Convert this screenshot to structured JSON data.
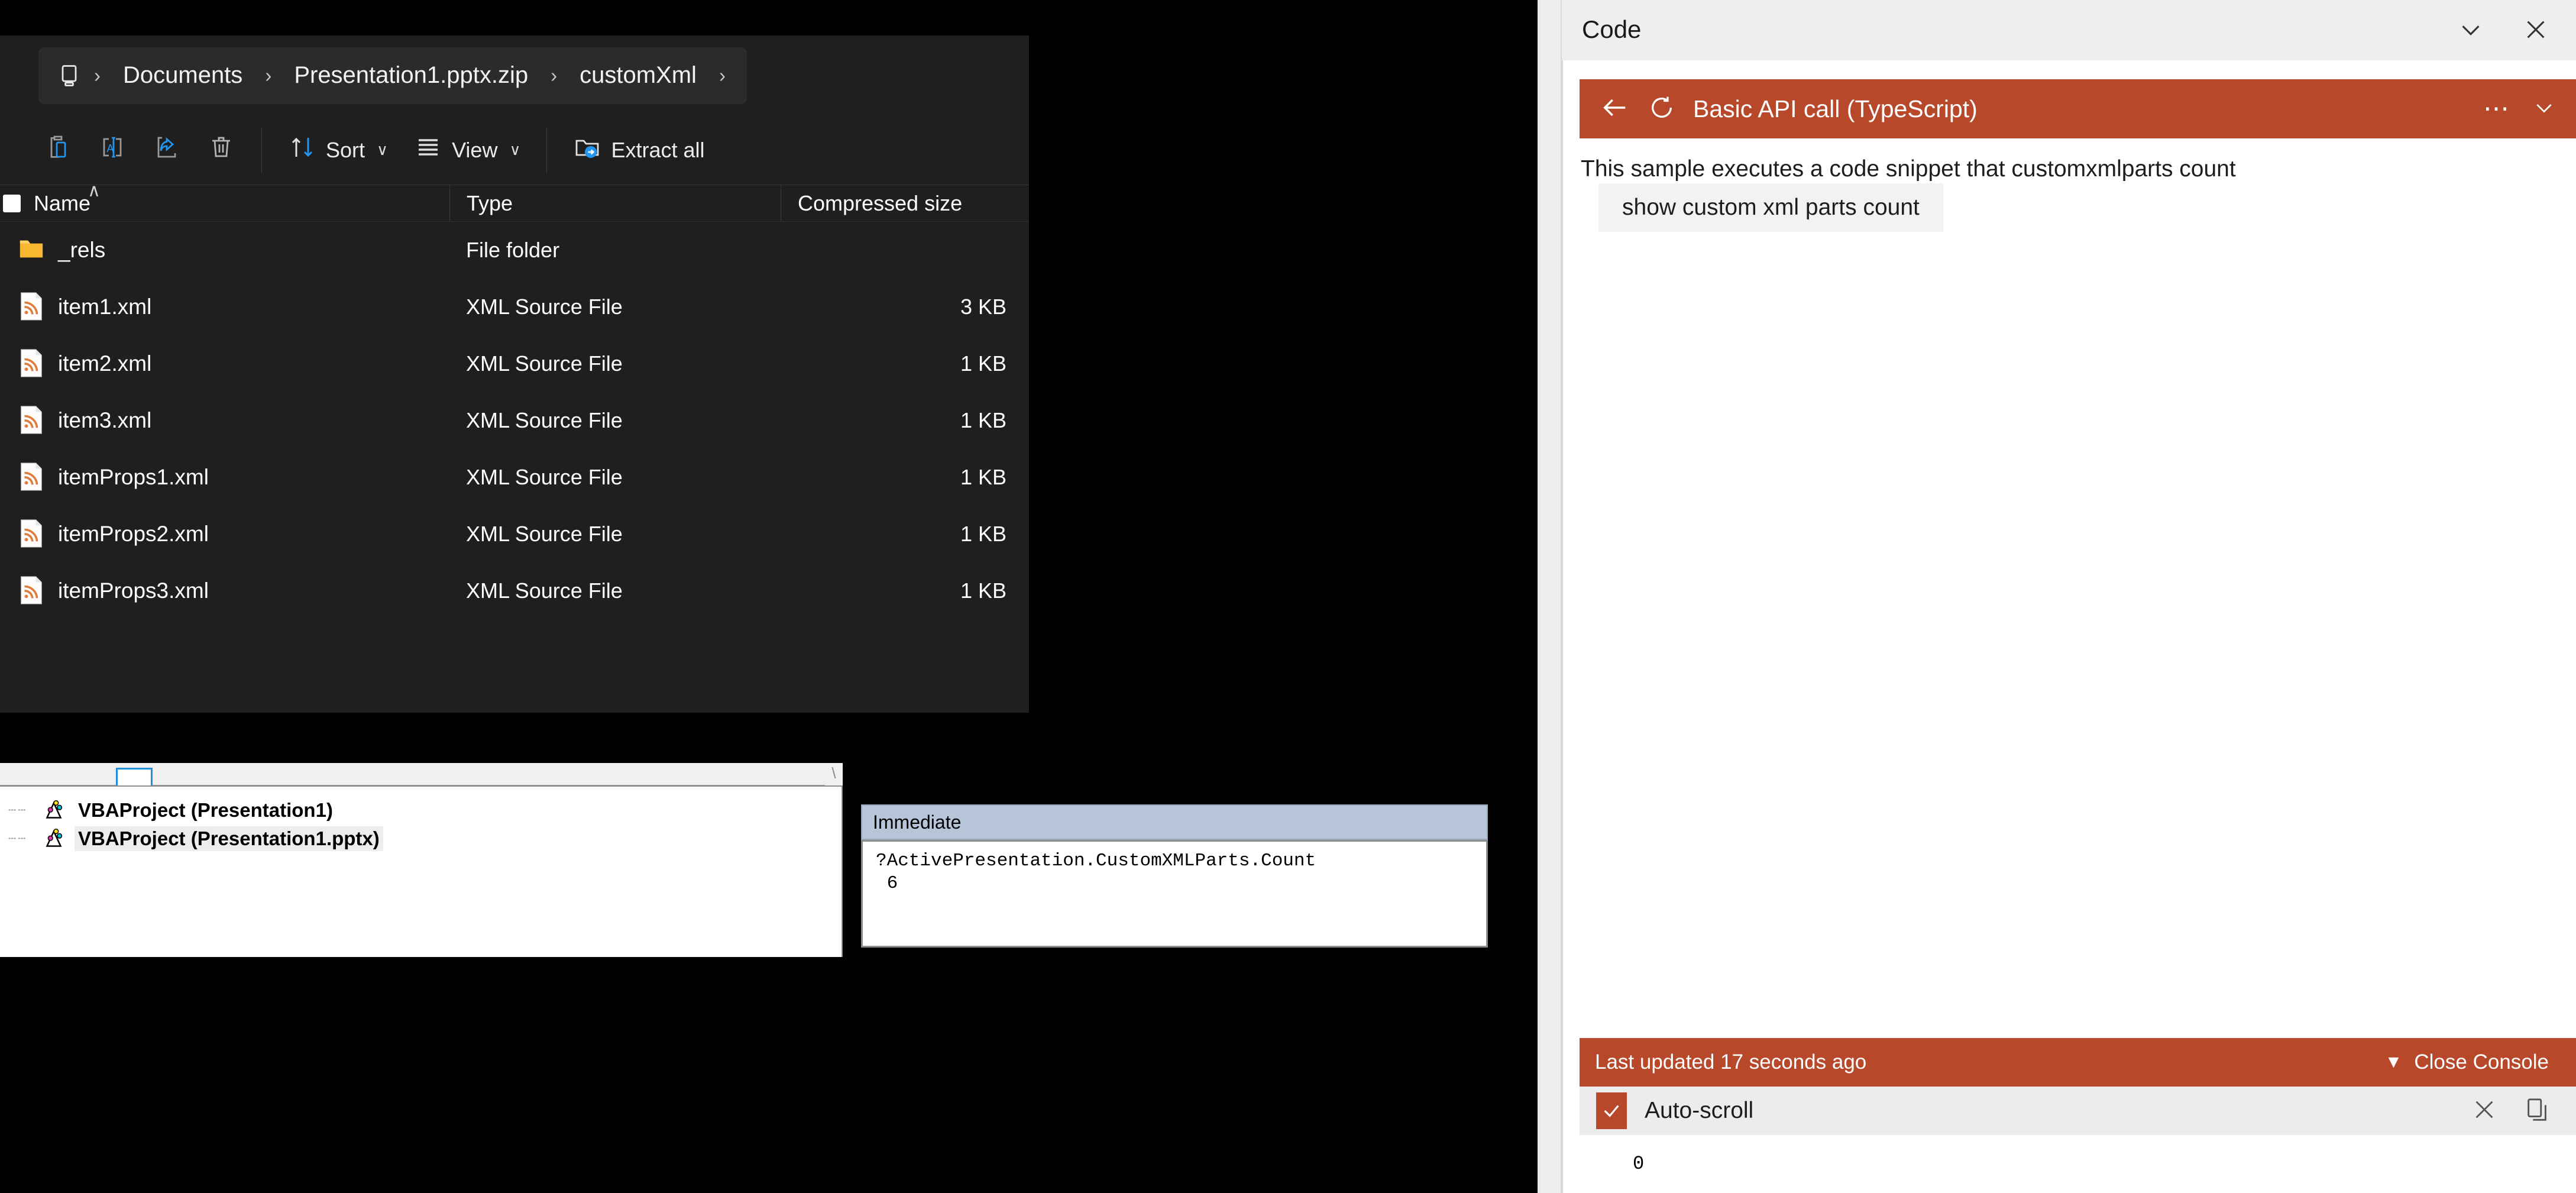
{
  "explorer": {
    "breadcrumb": {
      "root_icon": "this-pc-icon",
      "items": [
        "Documents",
        "Presentation1.pptx.zip",
        "customXml"
      ],
      "separator": "›"
    },
    "toolbar": {
      "buttons": [
        {
          "label": "",
          "icon": "paste-icon"
        },
        {
          "label": "",
          "icon": "rename-icon"
        },
        {
          "label": "",
          "icon": "share-icon"
        },
        {
          "label": "",
          "icon": "delete-icon"
        }
      ],
      "sort_label": "Sort",
      "view_label": "View",
      "extract_label": "Extract all",
      "chevron": "∨"
    },
    "columns": [
      "Name",
      "Type",
      "Compressed size"
    ],
    "sort_indicator": "∧",
    "rows": [
      {
        "name": "_rels",
        "type": "File folder",
        "size": "",
        "icon": "folder-icon"
      },
      {
        "name": "item1.xml",
        "type": "XML Source File",
        "size": "3 KB",
        "icon": "xml-file-icon"
      },
      {
        "name": "item2.xml",
        "type": "XML Source File",
        "size": "1 KB",
        "icon": "xml-file-icon"
      },
      {
        "name": "item3.xml",
        "type": "XML Source File",
        "size": "1 KB",
        "icon": "xml-file-icon"
      },
      {
        "name": "itemProps1.xml",
        "type": "XML Source File",
        "size": "1 KB",
        "icon": "xml-file-icon"
      },
      {
        "name": "itemProps2.xml",
        "type": "XML Source File",
        "size": "1 KB",
        "icon": "xml-file-icon"
      },
      {
        "name": "itemProps3.xml",
        "type": "XML Source File",
        "size": "1 KB",
        "icon": "xml-file-icon"
      }
    ]
  },
  "vba": {
    "project_tree": [
      {
        "label": "VBAProject (Presentation1)",
        "selected": false
      },
      {
        "label": "VBAProject (Presentation1.pptx)",
        "selected": true
      }
    ],
    "immediate": {
      "title": "Immediate",
      "lines": [
        "?ActivePresentation.CustomXMLParts.Count",
        " 6"
      ]
    }
  },
  "addin": {
    "panel_title": "Code",
    "header_icons": {
      "collapse": "chevron-down-icon",
      "close": "close-icon"
    },
    "sample": {
      "back_icon": "back-arrow-icon",
      "spinner_icon": "refresh-icon",
      "title": "Basic API call (TypeScript)",
      "overflow": "⋯",
      "chevron": "∨",
      "description": "This sample executes a code snippet that customxmlparts count",
      "run_button": "show custom xml parts count"
    },
    "console": {
      "status": "Last updated 17 seconds ago",
      "close_label": "Close Console",
      "triangle": "▼",
      "autoscroll_label": "Auto-scroll",
      "autoscroll_checked": true,
      "clear_icon": "close-icon",
      "copy_icon": "copy-icon",
      "output": "0"
    }
  },
  "colors": {
    "accent_orange": "#b7482a",
    "explorer_bg": "#1f1f1f",
    "panel_bg": "#eeeeee",
    "blue_accent": "#2196f3"
  }
}
